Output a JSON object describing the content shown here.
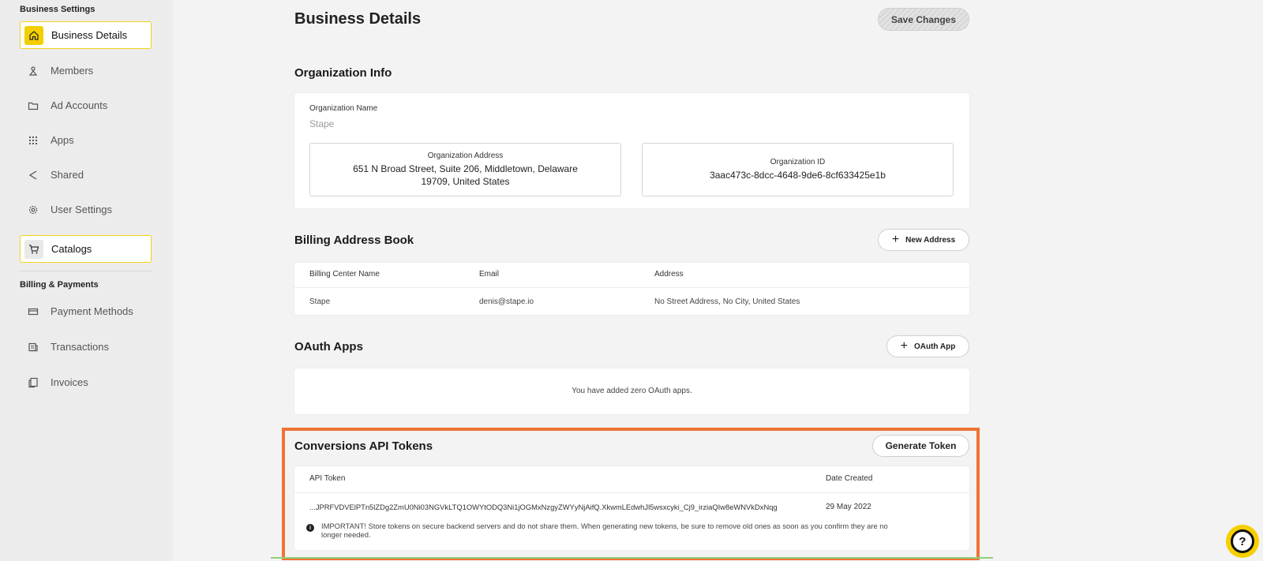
{
  "sidebar": {
    "section1": "Business Settings",
    "items": [
      {
        "label": "Business Details",
        "icon": "home-icon"
      },
      {
        "label": "Members",
        "icon": "members-icon"
      },
      {
        "label": "Ad Accounts",
        "icon": "folder-icon"
      },
      {
        "label": "Apps",
        "icon": "grid-icon"
      },
      {
        "label": "Shared",
        "icon": "share-icon"
      },
      {
        "label": "User Settings",
        "icon": "gear-icon"
      },
      {
        "label": "Catalogs",
        "icon": "cart-icon"
      }
    ],
    "section2": "Billing & Payments",
    "billing_items": [
      {
        "label": "Payment Methods",
        "icon": "card-icon"
      },
      {
        "label": "Transactions",
        "icon": "receipt-icon"
      },
      {
        "label": "Invoices",
        "icon": "invoice-icon"
      }
    ]
  },
  "header": {
    "title": "Business Details",
    "save_label": "Save Changes"
  },
  "org": {
    "title": "Organization Info",
    "name_label": "Organization Name",
    "name_placeholder": "Stape",
    "address_label": "Organization Address",
    "address_line1": "651 N Broad Street, Suite 206, Middletown, Delaware",
    "address_line2": "19709, United States",
    "id_label": "Organization ID",
    "id_value": "3aac473c-8dcc-4648-9de6-8cf633425e1b"
  },
  "billing": {
    "title": "Billing Address Book",
    "new_button": "New Address",
    "columns": [
      "Billing Center Name",
      "Email",
      "Address"
    ],
    "rows": [
      [
        "Stape",
        "denis@stape.io",
        "No Street Address, No City, United States"
      ]
    ]
  },
  "oauth": {
    "title": "OAuth Apps",
    "button": "OAuth App",
    "empty": "You have added zero OAuth apps."
  },
  "capi": {
    "title": "Conversions API Tokens",
    "button": "Generate Token",
    "col_token": "API Token",
    "col_date": "Date Created",
    "token": "...JPRFVDVElPTn5lZDg2ZmU0Ni03NGVkLTQ1OWYtODQ3Ni1jOGMxNzgyZWYyNjAifQ.XkwmLEdwhJl5wsxcyki_Cj9_irziaQIw8eWNVkDxNqg",
    "date": "29 May 2022",
    "notice_line1": "IMPORTANT! Store tokens on secure backend servers and do not share them. When generating new tokens, be sure to remove old ones as soon as you confirm they are no",
    "notice_line2": "longer needed."
  },
  "colors": {
    "accent": "#f4cf00",
    "highlight": "#ee7334"
  }
}
